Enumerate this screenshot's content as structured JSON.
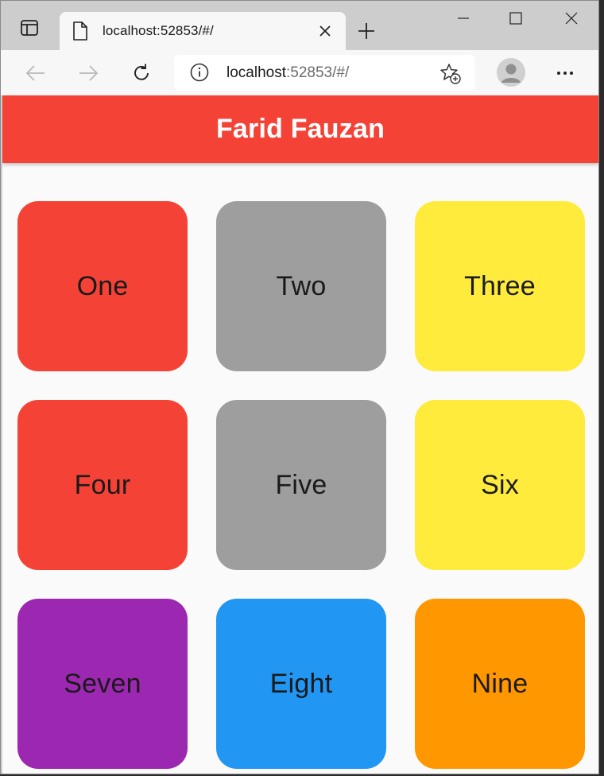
{
  "browser": {
    "tab": {
      "title": "localhost:52853/#/"
    },
    "address": {
      "host": "localhost",
      "rest": ":52853/#/"
    },
    "icons": {
      "tab_actions": "tab-actions-icon",
      "file": "file-icon",
      "close": "close-icon",
      "new_tab": "plus-icon",
      "back": "arrow-left-icon",
      "forward": "arrow-right-icon",
      "refresh": "refresh-icon",
      "info": "info-icon",
      "favorite": "star-add-icon",
      "profile": "avatar-icon",
      "more": "more-icon",
      "minimize": "minimize-icon",
      "maximize": "maximize-icon",
      "window_close": "window-close-icon"
    }
  },
  "app": {
    "title": "Farid Fauzan",
    "header_color": "#f44336",
    "tiles": [
      {
        "label": "One",
        "color": "#f44336"
      },
      {
        "label": "Two",
        "color": "#9e9e9e"
      },
      {
        "label": "Three",
        "color": "#ffeb3b"
      },
      {
        "label": "Four",
        "color": "#f44336"
      },
      {
        "label": "Five",
        "color": "#9e9e9e"
      },
      {
        "label": "Six",
        "color": "#ffeb3b"
      },
      {
        "label": "Seven",
        "color": "#9c27b0"
      },
      {
        "label": "Eight",
        "color": "#2196f3"
      },
      {
        "label": "Nine",
        "color": "#ff9800"
      }
    ]
  }
}
